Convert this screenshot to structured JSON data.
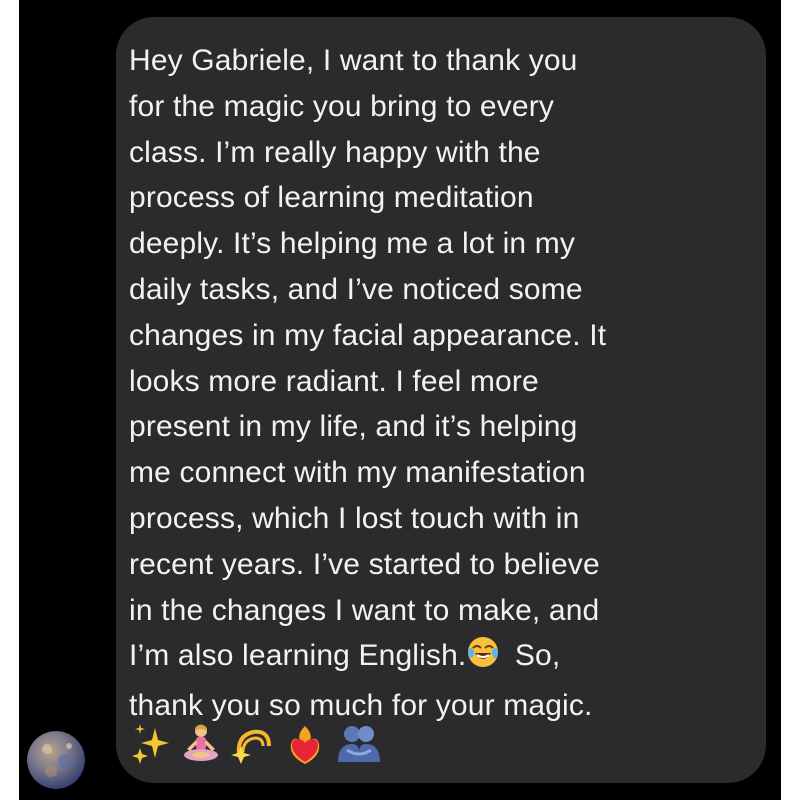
{
  "message": {
    "lines": [
      "Hey Gabriele, I want to thank you",
      "for the magic you bring to every",
      "class. I’m really happy with the",
      "process of learning meditation",
      "deeply. It’s helping me a lot in my",
      "daily tasks, and I’ve noticed some",
      "changes in my facial appearance. It",
      "looks more radiant. I feel more",
      "present in my life, and it’s helping",
      "me connect with my manifestation",
      "process, which I lost touch with in",
      "recent years. I’ve started to believe",
      "in the changes I want to make, and",
      "I’m also learning English.",
      " So,",
      "thank you so much for your magic."
    ],
    "inline_emoji": "face-with-tears-of-joy-icon",
    "trailing_emojis": [
      "sparkles-icon",
      "person-in-lotus-position-icon",
      "dizzy-icon",
      "heart-on-fire-icon",
      "people-hugging-icon"
    ]
  },
  "sender": {
    "avatar": "planet-avatar"
  },
  "colors": {
    "background": "#000000",
    "bubble": "#2b2b2d",
    "text": "#f2f2f2"
  }
}
